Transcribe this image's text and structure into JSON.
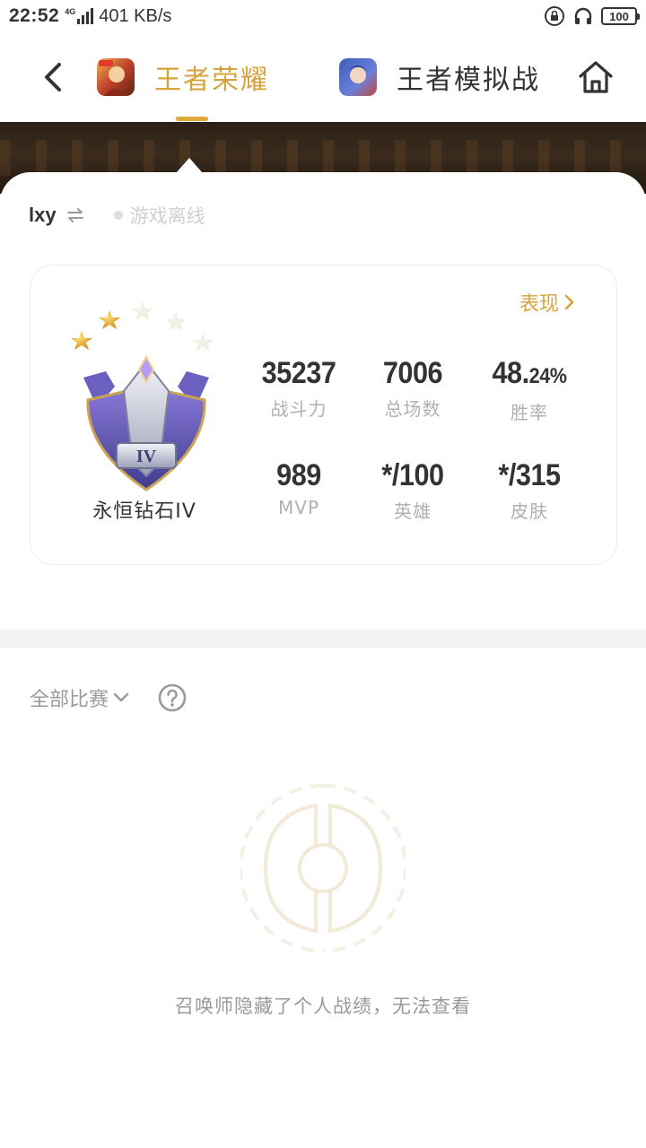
{
  "status_bar": {
    "time": "22:52",
    "network": "4G",
    "speed": "401 KB/s",
    "battery": "100"
  },
  "nav": {
    "tabs": [
      {
        "label": "王者荣耀",
        "active": true
      },
      {
        "label": "王者模拟战",
        "active": false
      }
    ]
  },
  "profile": {
    "account_name": "lxy",
    "online_status": "游戏离线",
    "performance_link": "表现",
    "rank": {
      "name": "永恒钻石IV",
      "tier_numeral": "IV",
      "stars_filled": 2,
      "stars_total": 5
    },
    "stats": [
      {
        "value": "35237",
        "label": "战斗力"
      },
      {
        "value": "7006",
        "label": "总场数"
      },
      {
        "value_main": "48.",
        "value_small": "24%",
        "label": "胜率"
      },
      {
        "value": "989",
        "label": "MVP"
      },
      {
        "value": "*/100",
        "label": "英雄"
      },
      {
        "value": "*/315",
        "label": "皮肤"
      }
    ]
  },
  "matches": {
    "filter_label": "全部比赛",
    "empty_message": "召唤师隐藏了个人战绩，无法查看"
  },
  "colors": {
    "accent": "#d9a441",
    "text": "#333333",
    "muted": "#b0b0b0"
  }
}
